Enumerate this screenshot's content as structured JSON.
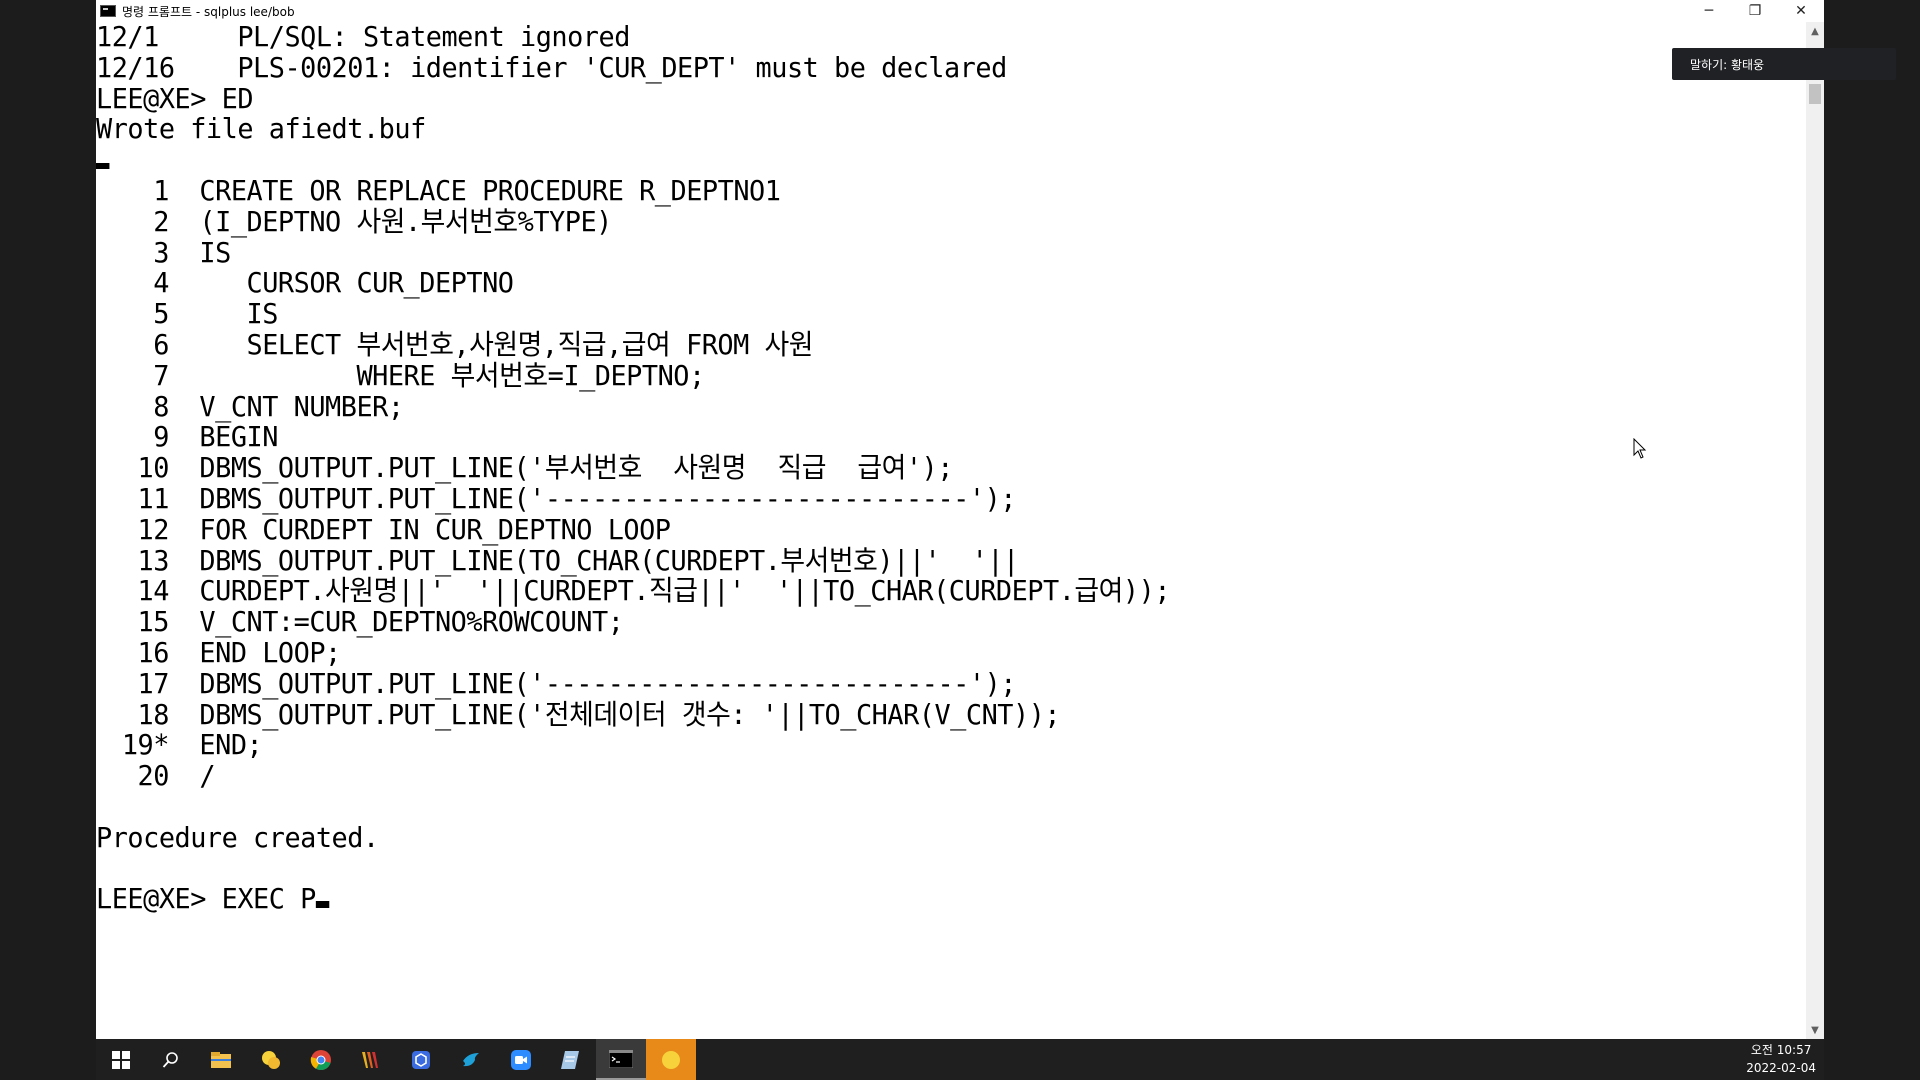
{
  "window": {
    "title": "명령 프롬프트 - sqlplus  lee/bob",
    "minimize": "─",
    "maximize": "❐",
    "close": "✕"
  },
  "console": {
    "pre_lines": [
      "12/1     PL/SQL: Statement ignored",
      "12/16    PLS-00201: identifier 'CUR_DEPT' must be declared",
      "LEE@XE> ED",
      "Wrote file afiedt.buf"
    ],
    "code_lines": [
      {
        "num": "1",
        "text": "CREATE OR REPLACE PROCEDURE R_DEPTNO1"
      },
      {
        "num": "2",
        "text": "(I_DEPTNO 사원.부서번호%TYPE)"
      },
      {
        "num": "3",
        "text": "IS"
      },
      {
        "num": "4",
        "text": "   CURSOR CUR_DEPTNO"
      },
      {
        "num": "5",
        "text": "   IS"
      },
      {
        "num": "6",
        "text": "   SELECT 부서번호,사원명,직급,급여 FROM 사원"
      },
      {
        "num": "7",
        "text": "          WHERE 부서번호=I_DEPTNO;"
      },
      {
        "num": "8",
        "text": "V_CNT NUMBER;"
      },
      {
        "num": "9",
        "text": "BEGIN"
      },
      {
        "num": "10",
        "text": "DBMS_OUTPUT.PUT_LINE('부서번호  사원명  직급  급여');"
      },
      {
        "num": "11",
        "text": "DBMS_OUTPUT.PUT_LINE('---------------------------');"
      },
      {
        "num": "12",
        "text": "FOR CURDEPT IN CUR_DEPTNO LOOP"
      },
      {
        "num": "13",
        "text": "DBMS_OUTPUT.PUT_LINE(TO_CHAR(CURDEPT.부서번호)||'  '||"
      },
      {
        "num": "14",
        "text": "CURDEPT.사원명||'  '||CURDEPT.직급||'  '||TO_CHAR(CURDEPT.급여));"
      },
      {
        "num": "15",
        "text": "V_CNT:=CUR_DEPTNO%ROWCOUNT;"
      },
      {
        "num": "16",
        "text": "END LOOP;"
      },
      {
        "num": "17",
        "text": "DBMS_OUTPUT.PUT_LINE('---------------------------');"
      },
      {
        "num": "18",
        "text": "DBMS_OUTPUT.PUT_LINE('전체데이터 갯수: '||TO_CHAR(V_CNT));"
      },
      {
        "num": "19*",
        "text": "END;"
      },
      {
        "num": "20",
        "text": "/"
      }
    ],
    "result": "Procedure created.",
    "prompt": "LEE@XE> EXEC P"
  },
  "speaking_toast": "말하기: 황태웅",
  "taskbar": {
    "icons": [
      "windows-start-icon",
      "search-icon",
      "file-explorer-icon",
      "kakaotalk-icon",
      "chrome-icon",
      "winamp-icon",
      "shield-app-icon",
      "bird-app-icon",
      "zoom-icon",
      "notepad-icon",
      "cmd-icon",
      "yellow-circle-app-icon"
    ],
    "clock_time": "오전 10:57",
    "clock_date": "2022-02-04"
  }
}
